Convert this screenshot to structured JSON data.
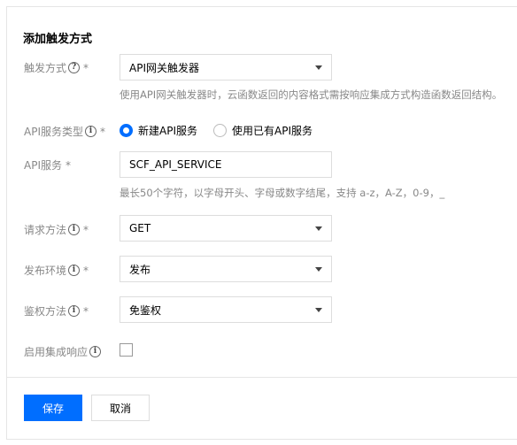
{
  "form": {
    "title": "添加触发方式",
    "trigger": {
      "label": "触发方式",
      "required": "*",
      "help_icon": "question-circle-icon",
      "value": "API网关触发器",
      "hint": "使用API网关触发器时，云函数返回的内容格式需按响应集成方式构造函数返回结构。"
    },
    "api_service_type": {
      "label": "API服务类型",
      "required": "*",
      "help_icon": "info-circle-icon",
      "options": [
        "新建API服务",
        "使用已有API服务"
      ],
      "selected": "新建API服务"
    },
    "api_service": {
      "label": "API服务",
      "required": "*",
      "value": "SCF_API_SERVICE",
      "hint": "最长50个字符，以字母开头、字母或数字结尾，支持 a-z，A-Z，0-9，_"
    },
    "method": {
      "label": "请求方法",
      "required": "*",
      "help_icon": "info-circle-icon",
      "value": "GET"
    },
    "environment": {
      "label": "发布环境",
      "required": "*",
      "help_icon": "info-circle-icon",
      "value": "发布"
    },
    "auth": {
      "label": "鉴权方法",
      "required": "*",
      "help_icon": "info-circle-icon",
      "value": "免鉴权"
    },
    "integration_response": {
      "label": "启用集成响应",
      "help_icon": "info-circle-icon",
      "checked": false
    }
  },
  "actions": {
    "save_label": "保存",
    "cancel_label": "取消"
  },
  "colors": {
    "primary": "#006eff",
    "border": "#dddddd",
    "label": "#888888"
  }
}
